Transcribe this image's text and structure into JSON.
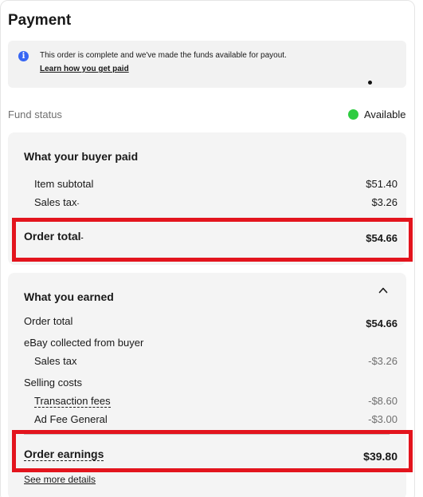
{
  "page": {
    "title": "Payment"
  },
  "info": {
    "message": "This order is complete and we've made the funds available for payout.",
    "link": "Learn how you get paid"
  },
  "fund": {
    "label": "Fund status",
    "status": "Available",
    "status_color": "#2ecc40"
  },
  "buyer_paid": {
    "heading": "What your buyer paid",
    "item_subtotal_label": "Item subtotal",
    "item_subtotal_value": "$51.40",
    "sales_tax_label": "Sales tax",
    "sales_tax_value": "$3.26",
    "order_total_label": "Order total",
    "order_total_value": "$54.66"
  },
  "earned": {
    "heading": "What you earned",
    "order_total_label": "Order total",
    "order_total_value": "$54.66",
    "ebay_collected_label": "eBay collected from buyer",
    "sales_tax_label": "Sales tax",
    "sales_tax_value": "-$3.26",
    "selling_costs_label": "Selling costs",
    "transaction_fees_label": "Transaction fees",
    "transaction_fees_value": "-$8.60",
    "ad_fee_label": "Ad Fee General",
    "ad_fee_value": "-$3.00",
    "order_earnings_label": "Order earnings",
    "order_earnings_value": "$39.80",
    "more_details": "See more details"
  },
  "colors": {
    "highlight": "#e3141d",
    "info_icon": "#3665f3"
  }
}
